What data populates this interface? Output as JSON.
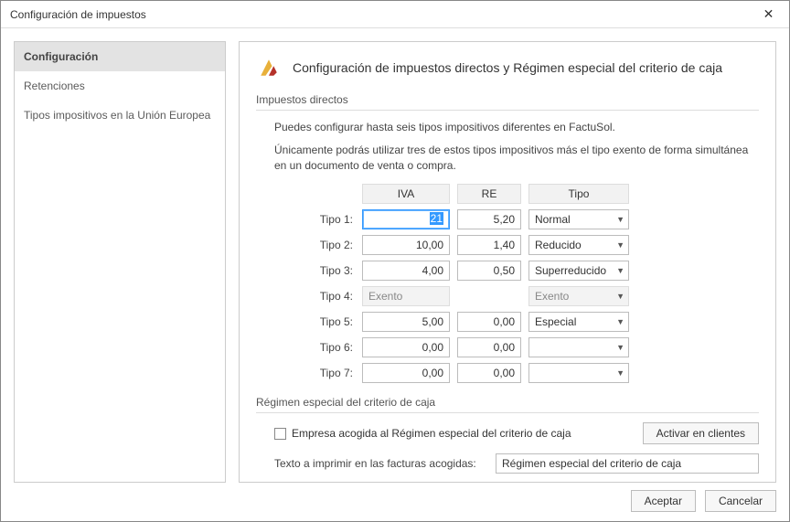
{
  "window": {
    "title": "Configuración de impuestos"
  },
  "sidebar": {
    "items": [
      {
        "label": "Configuración",
        "active": true
      },
      {
        "label": "Retenciones",
        "active": false
      },
      {
        "label": "Tipos impositivos en la Unión Europea",
        "active": false
      }
    ]
  },
  "main": {
    "title": "Configuración de impuestos directos y Régimen especial del criterio de caja",
    "section1": {
      "label": "Impuestos directos",
      "desc1": "Puedes configurar hasta seis tipos impositivos diferentes en FactuSol.",
      "desc2": "Únicamente podrás utilizar tres de estos tipos impositivos más el tipo exento de forma simultánea en un documento de venta o compra.",
      "headers": {
        "iva": "IVA",
        "re": "RE",
        "tipo": "Tipo"
      },
      "rows": [
        {
          "label": "Tipo 1:",
          "iva": "21",
          "re": "5,20",
          "tipo": "Normal",
          "active": true
        },
        {
          "label": "Tipo 2:",
          "iva": "10,00",
          "re": "1,40",
          "tipo": "Reducido"
        },
        {
          "label": "Tipo 3:",
          "iva": "4,00",
          "re": "0,50",
          "tipo": "Superreducido"
        },
        {
          "label": "Tipo 4:",
          "iva": "Exento",
          "re": "",
          "tipo": "Exento",
          "disabled": true
        },
        {
          "label": "Tipo 5:",
          "iva": "5,00",
          "re": "0,00",
          "tipo": "Especial"
        },
        {
          "label": "Tipo 6:",
          "iva": "0,00",
          "re": "0,00",
          "tipo": ""
        },
        {
          "label": "Tipo 7:",
          "iva": "0,00",
          "re": "0,00",
          "tipo": ""
        }
      ]
    },
    "section2": {
      "label": "Régimen especial del criterio de caja",
      "checkbox_label": "Empresa acogida al Régimen especial del criterio de caja",
      "btn_activar": "Activar en clientes",
      "texto_label": "Texto a imprimir en las facturas acogidas:",
      "texto_value": "Régimen especial del criterio de caja"
    }
  },
  "footer": {
    "ok": "Aceptar",
    "cancel": "Cancelar"
  }
}
